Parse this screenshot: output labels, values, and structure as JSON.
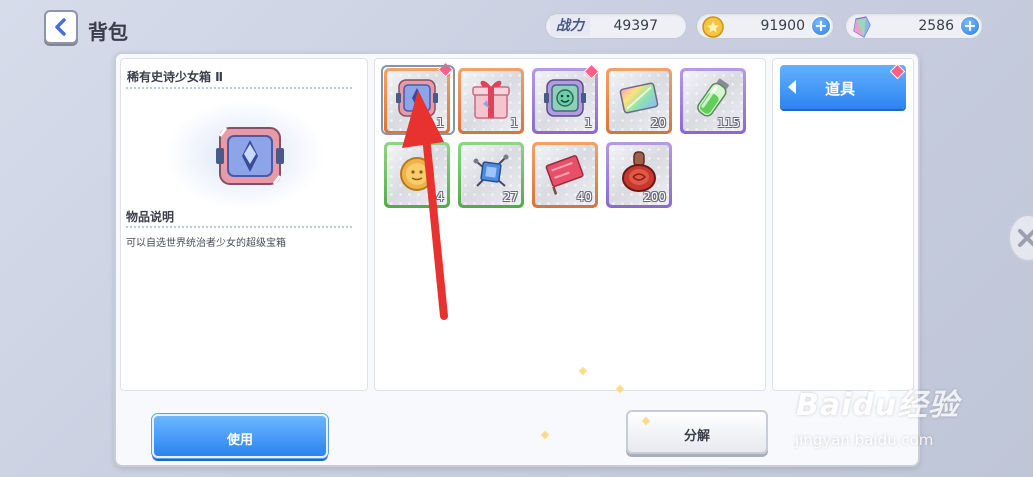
{
  "header": {
    "title": "背包",
    "power_label": "战力",
    "power_value": "49397",
    "gold_value": "91900",
    "gem_value": "2586"
  },
  "detail": {
    "item_name": "稀有史诗少女箱 Ⅱ",
    "desc_title": "物品说明",
    "desc_text": "可以自选世界统治者少女的超级宝箱"
  },
  "items": [
    {
      "name": "rare-epic-girl-chest",
      "count": "1",
      "rarity": "orange",
      "icon": "chest-icon",
      "badge": true
    },
    {
      "name": "gift-box",
      "count": "1",
      "rarity": "orange",
      "icon": "gift-box-icon",
      "badge": false
    },
    {
      "name": "smile-chest",
      "count": "1",
      "rarity": "purple",
      "icon": "chest-icon",
      "badge": true
    },
    {
      "name": "rainbow-card",
      "count": "20",
      "rarity": "orange",
      "icon": "card-icon",
      "badge": false
    },
    {
      "name": "green-potion",
      "count": "115",
      "rarity": "purple",
      "icon": "potion-icon",
      "badge": false
    },
    {
      "name": "gold-coin",
      "count": "4",
      "rarity": "green",
      "icon": "coin-icon",
      "badge": false
    },
    {
      "name": "blue-scroll",
      "count": "27",
      "rarity": "green",
      "icon": "scroll-icon",
      "badge": false
    },
    {
      "name": "red-flag",
      "count": "40",
      "rarity": "orange",
      "icon": "flag-icon",
      "badge": false
    },
    {
      "name": "red-seal",
      "count": "200",
      "rarity": "purple",
      "icon": "seal-icon",
      "badge": false
    }
  ],
  "tabs": {
    "items_label": "道具"
  },
  "buttons": {
    "use_label": "使用",
    "decompose_label": "分解"
  },
  "watermark": {
    "logo_text": "Baidu经验",
    "url": "jingyan.baidu.com"
  },
  "colors": {
    "accent_blue": "#2d84f0",
    "rarity_orange": "#d9733c",
    "rarity_purple": "#8a69cf",
    "rarity_green": "#55a94c",
    "badge_pink": "#ff5e86",
    "annotation_arrow": "#e8322f"
  }
}
